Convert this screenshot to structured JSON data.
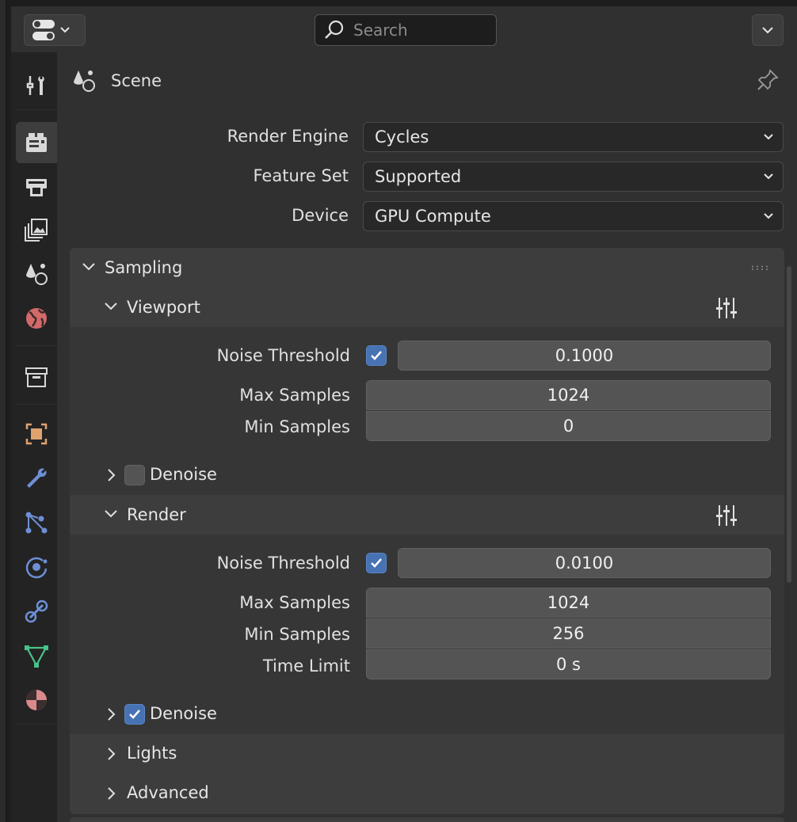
{
  "header": {
    "search_placeholder": "Search"
  },
  "tabs": [
    {
      "name": "tool",
      "active": false
    },
    {
      "name": "render",
      "active": true
    },
    {
      "name": "output",
      "active": false
    },
    {
      "name": "view-layer",
      "active": false
    },
    {
      "name": "scene",
      "active": false
    },
    {
      "name": "world",
      "active": false
    },
    {
      "name": "collection",
      "active": false
    },
    {
      "name": "object",
      "active": false
    },
    {
      "name": "modifier",
      "active": false
    },
    {
      "name": "particles",
      "active": false
    },
    {
      "name": "physics",
      "active": false
    },
    {
      "name": "constraints",
      "active": false
    },
    {
      "name": "data",
      "active": false
    },
    {
      "name": "material",
      "active": false
    }
  ],
  "context": {
    "label": "Scene"
  },
  "render_settings": {
    "render_engine_label": "Render Engine",
    "render_engine_value": "Cycles",
    "feature_set_label": "Feature Set",
    "feature_set_value": "Supported",
    "device_label": "Device",
    "device_value": "GPU Compute"
  },
  "sampling": {
    "title": "Sampling",
    "viewport": {
      "title": "Viewport",
      "noise_threshold_label": "Noise Threshold",
      "noise_threshold_enabled": true,
      "noise_threshold_value": "0.1000",
      "max_samples_label": "Max Samples",
      "max_samples_value": "1024",
      "min_samples_label": "Min Samples",
      "min_samples_value": "0",
      "denoise_label": "Denoise",
      "denoise_enabled": false
    },
    "render": {
      "title": "Render",
      "noise_threshold_label": "Noise Threshold",
      "noise_threshold_enabled": true,
      "noise_threshold_value": "0.0100",
      "max_samples_label": "Max Samples",
      "max_samples_value": "1024",
      "min_samples_label": "Min Samples",
      "min_samples_value": "256",
      "time_limit_label": "Time Limit",
      "time_limit_value": "0 s",
      "denoise_label": "Denoise",
      "denoise_enabled": true
    },
    "lights_title": "Lights",
    "advanced_title": "Advanced"
  },
  "colors": {
    "accent": "#4772b3",
    "panel_bg": "#303030",
    "field_bg": "#545454"
  }
}
